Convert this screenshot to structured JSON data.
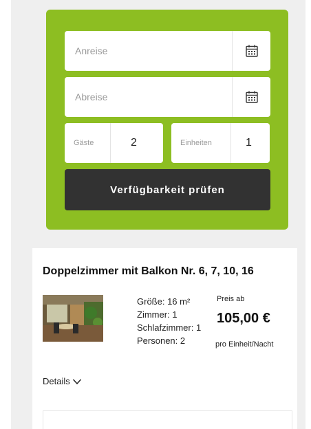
{
  "booking": {
    "arrival_placeholder": "Anreise",
    "departure_placeholder": "Abreise",
    "guests_label": "Gäste",
    "guests_value": "2",
    "units_label": "Einheiten",
    "units_value": "1",
    "check_button": "Verfügbarkeit prüfen",
    "calendar_icon": "calendar-icon",
    "panel_color": "#8dbe22",
    "button_color": "#323232"
  },
  "room": {
    "title": "Doppelzimmer mit Balkon Nr. 6, 7, 10, 16",
    "facts": {
      "size": "Größe: 16 m²",
      "rooms": "Zimmer: 1",
      "bedrooms": "Schlafzimmer: 1",
      "persons": "Personen: 2"
    },
    "price_from": "Preis ab",
    "price": "105,00 €",
    "price_unit": "pro Einheit/Nacht",
    "details_link": "Details",
    "details_icon": "chevron-down-icon"
  }
}
